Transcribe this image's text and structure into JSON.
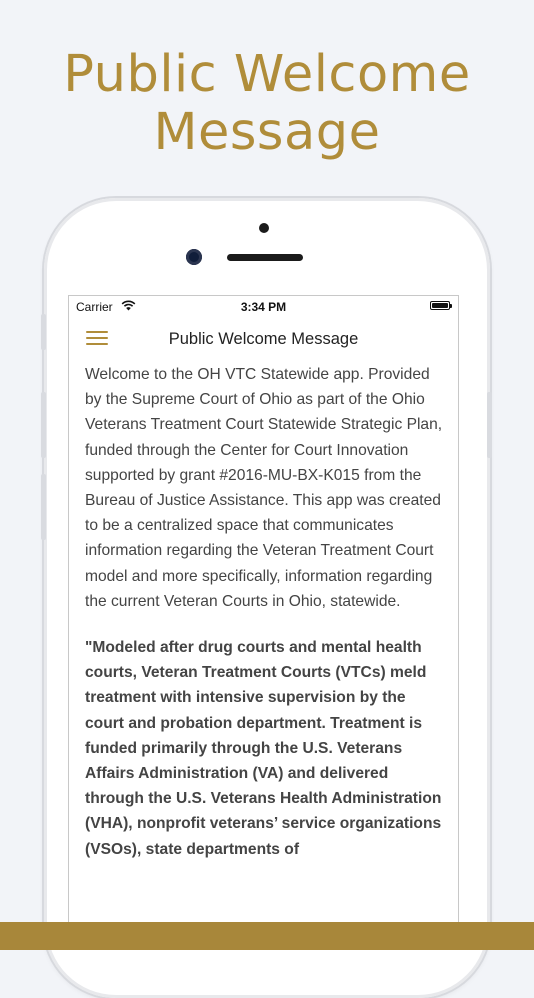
{
  "promo": {
    "headline_line1": "Public Welcome",
    "headline_line2": "Message"
  },
  "status_bar": {
    "carrier": "Carrier",
    "time": "3:34 PM"
  },
  "nav": {
    "title": "Public Welcome Message",
    "menu_icon": "hamburger-menu-icon"
  },
  "content": {
    "intro": "Welcome to the OH VTC Statewide app. Provided by the Supreme Court of Ohio as part of the Ohio Veterans Treatment Court Statewide Strategic Plan, funded through the Center for Court Innovation supported by grant #2016-MU-BX-K015 from the Bureau of Justice Assistance. This app was created to be a centralized space that communicates information regarding the Veteran Treatment Court model and more specifically, information regarding the current Veteran Courts in Ohio, statewide.",
    "quote": "\"Modeled after drug courts and mental health courts, Veteran Treatment Courts (VTCs) meld treatment with intensive supervision by the court and probation department. Treatment is funded primarily through the U.S. Veterans Affairs Administration (VA) and delivered through the U.S. Veterans Health Administration (VHA), nonprofit veterans’ service organizations (VSOs), state departments of"
  },
  "colors": {
    "accent_gold": "#b08d3a",
    "bottom_bar": "#a8873a",
    "background": "#f2f4f8"
  }
}
